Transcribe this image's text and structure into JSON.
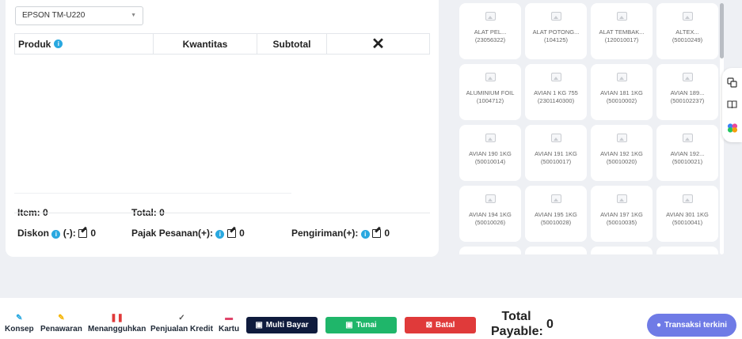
{
  "printer": {
    "selected": "EPSON TM-U220"
  },
  "cart": {
    "columns": {
      "produk": "Produk",
      "kwantitas": "Kwantitas",
      "subtotal": "Subtotal",
      "remove": "✕"
    }
  },
  "summary": {
    "item_label": "Item:",
    "item_value": "0",
    "total_label": "Total:",
    "total_value": "0",
    "diskon_label": "Diskon",
    "diskon_sign": "(-):",
    "diskon_value": "0",
    "pajak_label": "Pajak Pesanan(+):",
    "pajak_value": "0",
    "pengiriman_label": "Pengiriman(+):",
    "pengiriman_value": "0"
  },
  "products": [
    {
      "name": "ALAT PEL...",
      "code": "(23056322)"
    },
    {
      "name": "ALAT POTONG...",
      "code": "(104125)"
    },
    {
      "name": "ALAT TEMBAK...",
      "code": "(120010017)"
    },
    {
      "name": "ALTEX...",
      "code": "(50010249)"
    },
    {
      "name": "ALUMINIUM FOIL",
      "code": "(1004712)"
    },
    {
      "name": "AVIAN 1 KG 755",
      "code": "(2301140300)"
    },
    {
      "name": "AVIAN 181 1KG",
      "code": "(50010002)"
    },
    {
      "name": "AVIAN 189...",
      "code": "(500102237)"
    },
    {
      "name": "AVIAN 190 1KG",
      "code": "(50010014)"
    },
    {
      "name": "AVIAN 191 1KG",
      "code": "(50010017)"
    },
    {
      "name": "AVIAN 192 1KG",
      "code": "(50010020)"
    },
    {
      "name": "AVIAN 192...",
      "code": "(50010021)"
    },
    {
      "name": "AVIAN 194 1KG",
      "code": "(50010026)"
    },
    {
      "name": "AVIAN 195 1KG",
      "code": "(50010028)"
    },
    {
      "name": "AVIAN 197 1KG",
      "code": "(50010035)"
    },
    {
      "name": "AVIAN 301 1KG",
      "code": "(50010041)"
    },
    {
      "name": "",
      "code": ""
    },
    {
      "name": "",
      "code": ""
    },
    {
      "name": "",
      "code": ""
    },
    {
      "name": "",
      "code": ""
    }
  ],
  "footer": {
    "konsep": "Konsep",
    "penawaran": "Penawaran",
    "menangguhkan": "Menangguhkan",
    "penjualan_kredit": "Penjualan Kredit",
    "kartu": "Kartu",
    "multi_bayar": "Multi Bayar",
    "tunai": "Tunai",
    "batal": "Batal",
    "total_payable_label": "Total Payable:",
    "total_payable_value": "0",
    "transaksi_terkini": "Transaksi terkini"
  },
  "colors": {
    "multi_bayar": "#0f1b3d",
    "tunai": "#1fb66a",
    "batal": "#e03a3a",
    "transaksi_terkini": "#6f7be6",
    "info": "#29a8e0"
  }
}
